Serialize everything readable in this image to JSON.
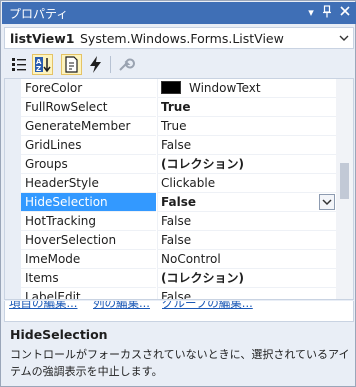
{
  "panel": {
    "title": "プロパティ",
    "pin_glyph": "▾",
    "autohide_glyph": "⊣",
    "close_glyph": "✕"
  },
  "object_selector": {
    "name": "listView1",
    "type": "System.Windows.Forms.ListView"
  },
  "toolbar": {
    "buttons": [
      {
        "icon": "categorized-icon",
        "selected": false
      },
      {
        "icon": "alphabetical-icon",
        "selected": true
      },
      {
        "icon": "properties-icon",
        "selected": true
      },
      {
        "icon": "events-icon",
        "selected": false
      },
      {
        "icon": "property-pages-icon",
        "selected": false
      }
    ]
  },
  "grid": {
    "rows": [
      {
        "name": "ForeColor",
        "value": "WindowText",
        "bold": false,
        "swatch": "#000000"
      },
      {
        "name": "FullRowSelect",
        "value": "True",
        "bold": true
      },
      {
        "name": "GenerateMember",
        "value": "True",
        "bold": false
      },
      {
        "name": "GridLines",
        "value": "False",
        "bold": false
      },
      {
        "name": "Groups",
        "value": "(コレクション)",
        "bold": true
      },
      {
        "name": "HeaderStyle",
        "value": "Clickable",
        "bold": false
      },
      {
        "name": "HideSelection",
        "value": "False",
        "bold": true,
        "selected": true
      },
      {
        "name": "HotTracking",
        "value": "False",
        "bold": false
      },
      {
        "name": "HoverSelection",
        "value": "False",
        "bold": false
      },
      {
        "name": "ImeMode",
        "value": "NoControl",
        "bold": false
      },
      {
        "name": "Items",
        "value": "(コレクション)",
        "bold": true
      },
      {
        "name": "LabelEdit",
        "value": "False",
        "bold": false
      }
    ]
  },
  "command_links": [
    "項目の編集...",
    "列の編集...",
    "グループの編集..."
  ],
  "description": {
    "title": "HideSelection",
    "text": "コントロールがフォーカスされていないときに、選択されているアイテムの強調表示を中止します。"
  },
  "colors": {
    "titlebar": "#3f6fb6",
    "selection": "#3399ff",
    "link": "#1a58b6"
  }
}
